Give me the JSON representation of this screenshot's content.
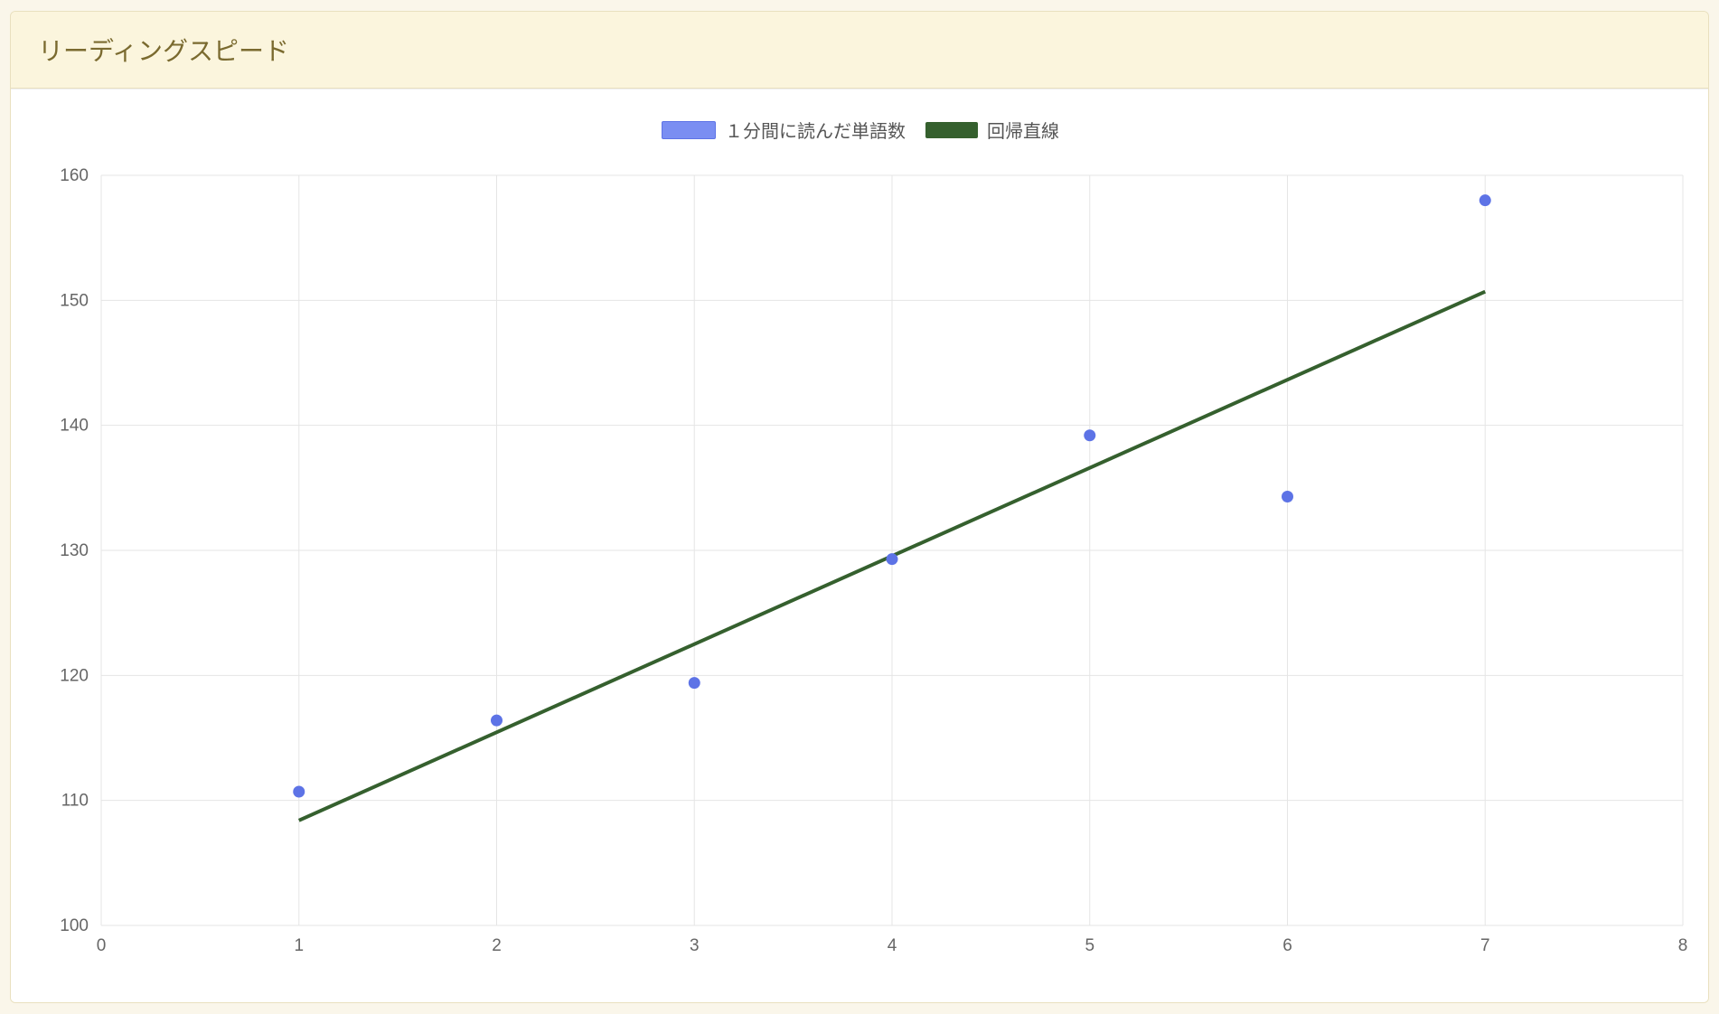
{
  "card": {
    "title": "リーディングスピード"
  },
  "legend": {
    "series1": "１分間に読んだ単語数",
    "series2": "回帰直線"
  },
  "chart_data": {
    "type": "scatter",
    "title": "リーディングスピード",
    "xlabel": "",
    "ylabel": "",
    "xlim": [
      0,
      8
    ],
    "ylim": [
      100,
      160
    ],
    "xticks": [
      0,
      1,
      2,
      3,
      4,
      5,
      6,
      7,
      8
    ],
    "yticks": [
      100,
      110,
      120,
      130,
      140,
      150,
      160
    ],
    "series": [
      {
        "name": "１分間に読んだ単語数",
        "type": "scatter",
        "color": "#5d73e6",
        "x": [
          1,
          2,
          3,
          4,
          5,
          6,
          7
        ],
        "y": [
          110.7,
          116.4,
          119.4,
          129.3,
          139.2,
          134.3,
          158.0
        ]
      },
      {
        "name": "回帰直線",
        "type": "line",
        "color": "#35602e",
        "x": [
          1,
          7
        ],
        "y": [
          108.4,
          150.7
        ]
      }
    ]
  }
}
